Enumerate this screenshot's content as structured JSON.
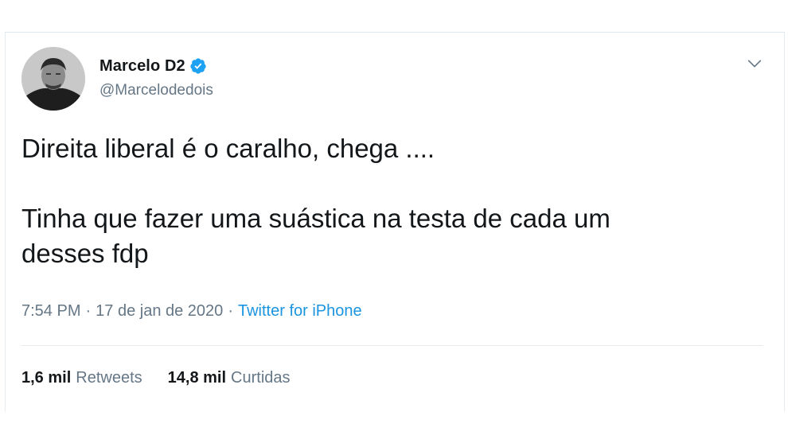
{
  "tweet": {
    "author": {
      "display_name": "Marcelo D2",
      "handle": "@Marcelodedois",
      "verified": true,
      "verified_color": "#1da1f2"
    },
    "text": "Direita liberal é o caralho, chega ....\n\nTinha que fazer uma suástica na testa de cada um\ndesses fdp",
    "meta": {
      "time": "7:54 PM",
      "separator_1": "·",
      "date": "17 de jan de 2020",
      "separator_2": "·",
      "source": "Twitter for iPhone",
      "source_color": "#1b95e0"
    },
    "stats": {
      "retweets_count": "1,6 mil",
      "retweets_label": "Retweets",
      "likes_count": "14,8 mil",
      "likes_label": "Curtidas"
    }
  },
  "icons": {
    "verified": "verified-badge-icon",
    "caret": "chevron-down-icon"
  }
}
